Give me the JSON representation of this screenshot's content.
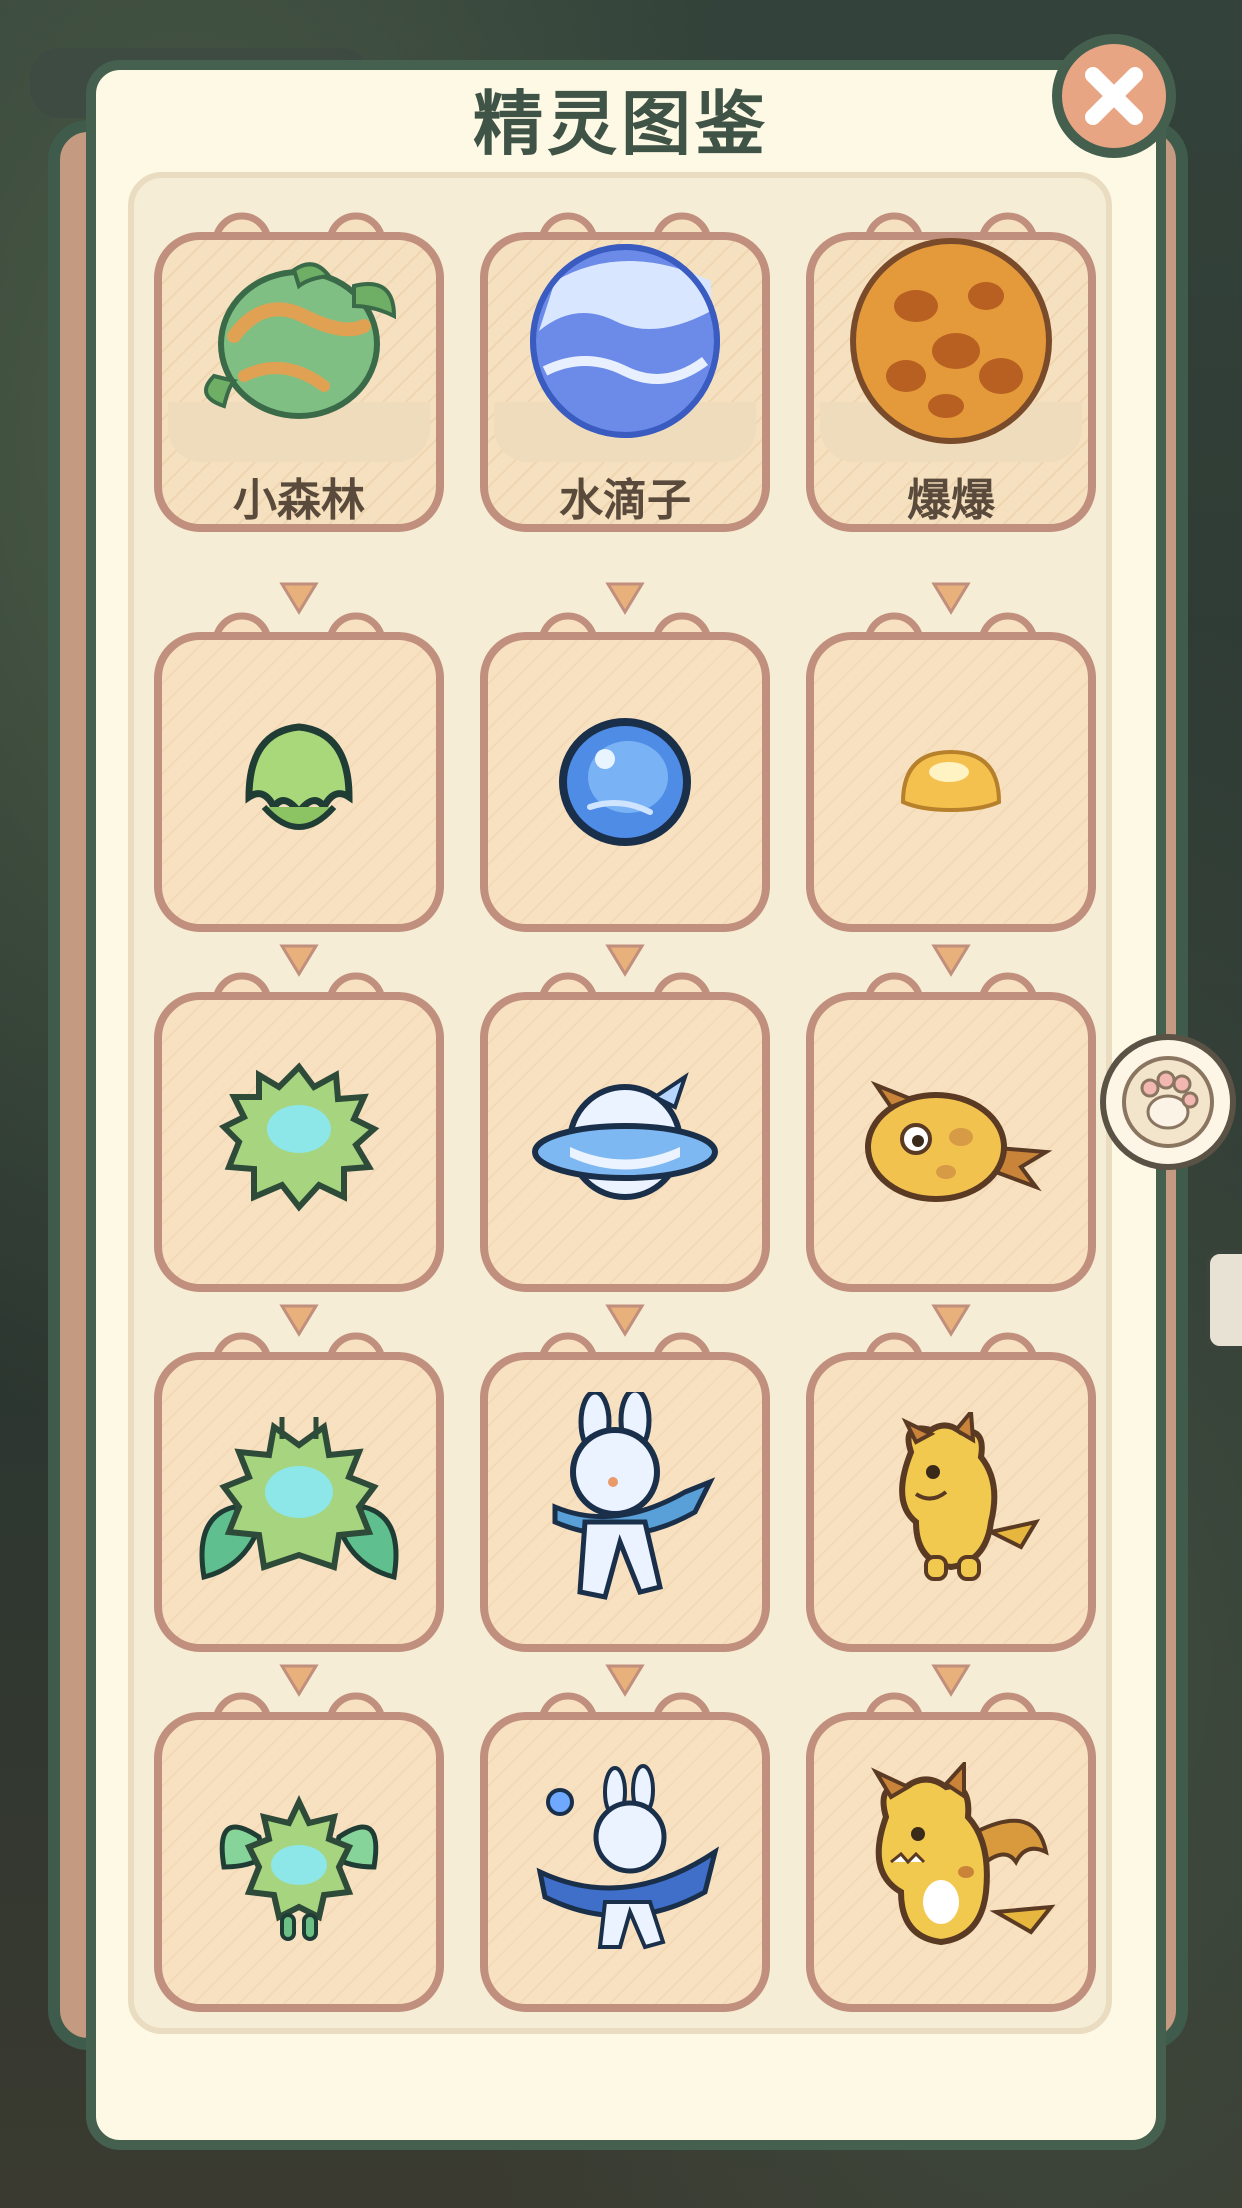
{
  "title": "精灵图鉴",
  "close_icon": "close-icon",
  "side_button_icon": "paw-icon",
  "colors": {
    "panel_bg": "#fdf9e4",
    "border_green": "#45604f",
    "card": "#f7e1c1",
    "card_border": "#c08f7d",
    "close_button": "#e8a584"
  },
  "columns": [
    {
      "egg_label": "小森林",
      "egg_icon": "forest-egg-icon",
      "stages": [
        "leaf-sprout-icon",
        "fuzzy-green-sprite-icon",
        "leaf-winged-sprite-icon",
        "forest-fairy-sprite-icon"
      ]
    },
    {
      "egg_label": "水滴子",
      "egg_icon": "water-egg-icon",
      "stages": [
        "water-drop-icon",
        "water-ring-sprite-icon",
        "water-bunny-sprite-icon",
        "water-bunny-final-icon"
      ]
    },
    {
      "egg_label": "爆爆",
      "egg_icon": "fire-egg-icon",
      "stages": [
        "fire-blob-icon",
        "fire-tadpole-sprite-icon",
        "fire-dino-sprite-icon",
        "fire-dragon-sprite-icon"
      ]
    }
  ]
}
